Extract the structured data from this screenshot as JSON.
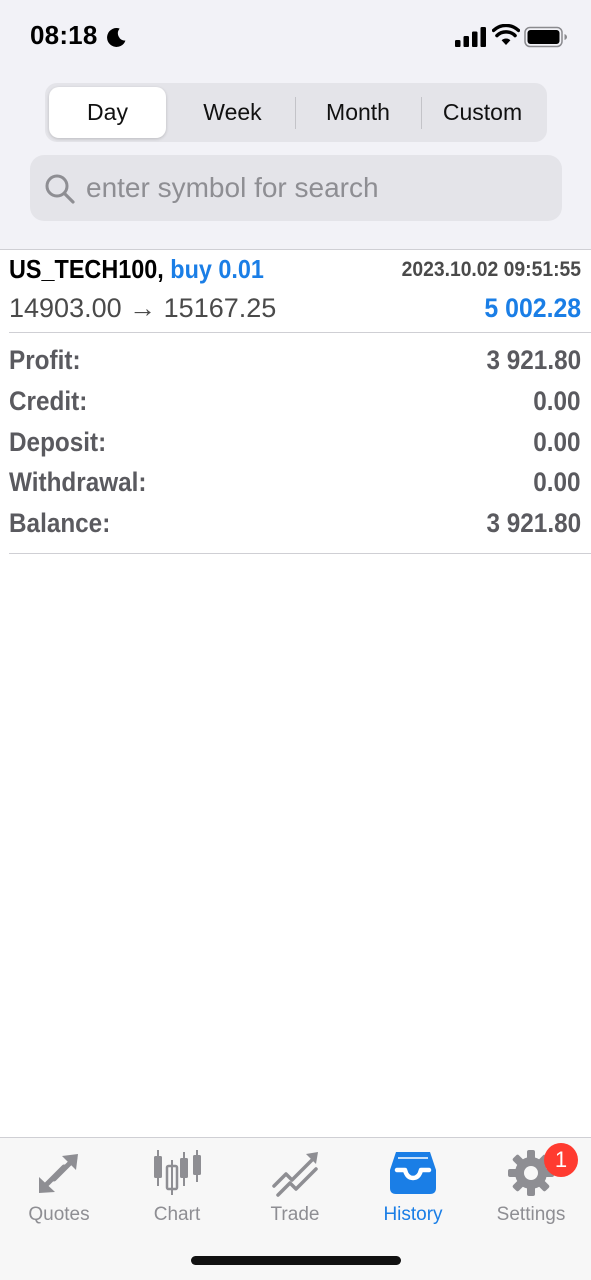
{
  "status_bar": {
    "time": "08:18"
  },
  "period_tabs": [
    {
      "label": "Day",
      "active": true
    },
    {
      "label": "Week",
      "active": false
    },
    {
      "label": "Month",
      "active": false
    },
    {
      "label": "Custom",
      "active": false
    }
  ],
  "search": {
    "placeholder": "enter symbol for search",
    "value": ""
  },
  "deal": {
    "symbol": "US_TECH100,",
    "type": "buy 0.01",
    "datetime": "2023.10.02 09:51:55",
    "open_price": "14903.00",
    "arrow": "→",
    "close_price": "15167.25",
    "profit": "5 002.28"
  },
  "summary": [
    {
      "label": "Profit:",
      "value": "3 921.80"
    },
    {
      "label": "Credit:",
      "value": "0.00"
    },
    {
      "label": "Deposit:",
      "value": "0.00"
    },
    {
      "label": "Withdrawal:",
      "value": "0.00"
    },
    {
      "label": "Balance:",
      "value": "3 921.80"
    }
  ],
  "tabbar": [
    {
      "label": "Quotes",
      "icon": "quotes-icon",
      "active": false
    },
    {
      "label": "Chart",
      "icon": "chart-icon",
      "active": false
    },
    {
      "label": "Trade",
      "icon": "trade-icon",
      "active": false
    },
    {
      "label": "History",
      "icon": "history-icon",
      "active": true
    },
    {
      "label": "Settings",
      "icon": "settings-icon",
      "active": false
    }
  ],
  "settings_badge": "1",
  "colors": {
    "accent": "#1a7ee6",
    "badge": "#ff3b30",
    "inactive": "#8e8e93"
  }
}
